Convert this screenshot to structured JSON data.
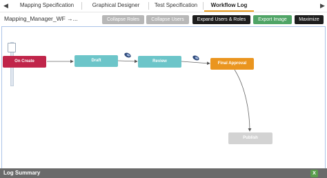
{
  "tabs": {
    "items": [
      {
        "label": "Mapping Specification"
      },
      {
        "label": "Graphical Designer"
      },
      {
        "label": "Test Specification"
      },
      {
        "label": "Workflow Log"
      }
    ],
    "active": "Workflow Log",
    "prev_arrow": "◀",
    "next_arrow": "▶"
  },
  "toolbar": {
    "workflow_name": "Mapping_Manager_WF →...",
    "buttons": {
      "collapse_roles": "Collapse Roles",
      "collapse_users": "Collapse Users",
      "expand_users_roles": "Expand Users & Roles",
      "export_image": "Export Image",
      "maximize": "Maximize"
    }
  },
  "workflow": {
    "nodes": {
      "on_create": "On Create",
      "draft": "Draft",
      "review": "Review",
      "final_approval": "Final Approval",
      "publish": "Publish"
    }
  },
  "footer": {
    "title": "Log Summary",
    "icon": "excel-export-icon"
  },
  "colors": {
    "active_tab": "#e89a1c",
    "on_create": "#c0254a",
    "draft": "#6cc5c9",
    "review": "#6cc5c9",
    "final_approval": "#ea951f",
    "publish": "#d3d3d3",
    "export_button": "#4fa466"
  }
}
